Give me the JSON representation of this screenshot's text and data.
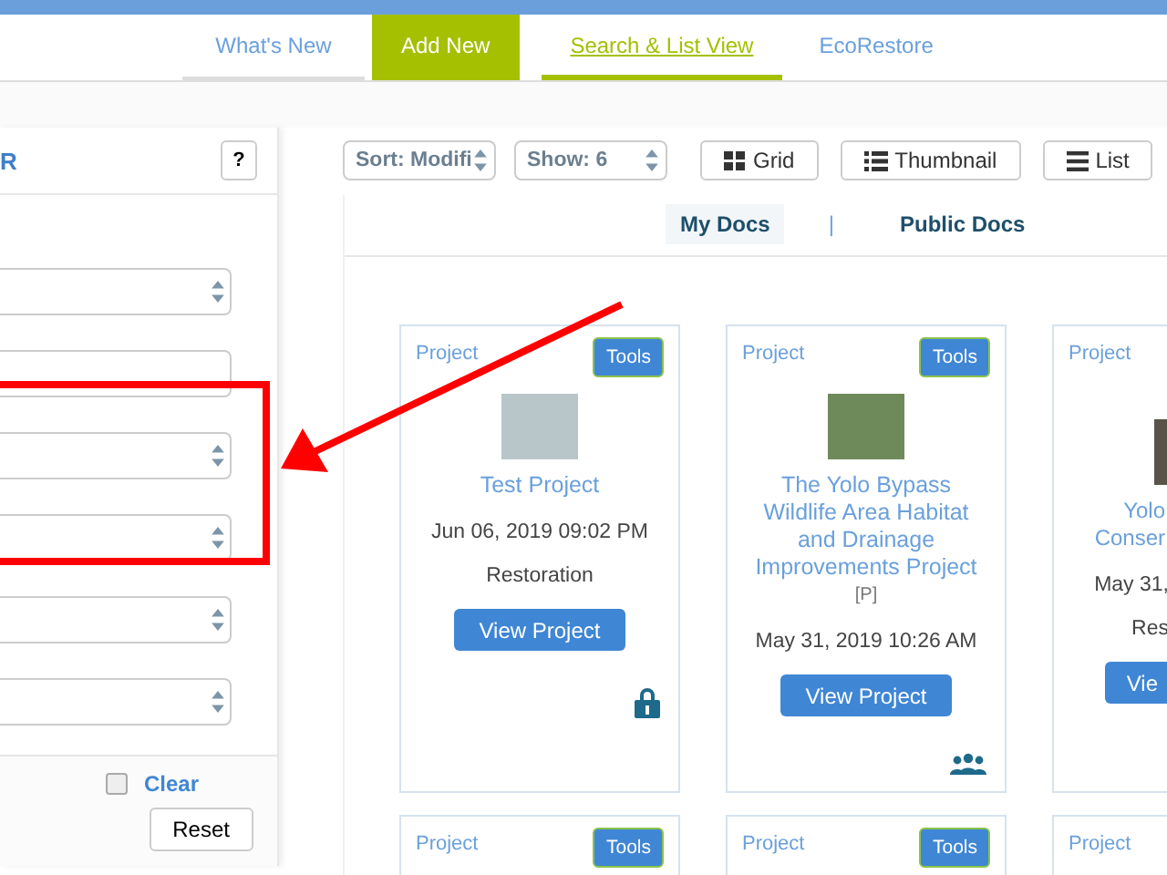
{
  "nav": {
    "tabs": [
      {
        "label": "What's New",
        "selected": false,
        "highlighted": false
      },
      {
        "label": "Add New",
        "selected": false,
        "highlighted": true
      },
      {
        "label": "Search & List View",
        "selected": true,
        "highlighted": false
      },
      {
        "label": "EcoRestore",
        "selected": false,
        "highlighted": false
      }
    ]
  },
  "filter_panel": {
    "title": "R",
    "help": "?",
    "fields": [
      {
        "kind": "select"
      },
      {
        "kind": "input"
      },
      {
        "kind": "select"
      },
      {
        "kind": "select"
      },
      {
        "kind": "select"
      },
      {
        "kind": "select"
      }
    ],
    "clear": {
      "label": "Clear",
      "checked": false
    },
    "reset": "Reset"
  },
  "toolbar": {
    "sort": "Sort: Modifi",
    "show": "Show: 6",
    "views": [
      {
        "label": "Grid",
        "kind": "grid"
      },
      {
        "label": "Thumbnail",
        "kind": "thumbnail"
      },
      {
        "label": "List",
        "kind": "list"
      }
    ]
  },
  "doc_tabs": {
    "tabs": [
      {
        "label": "My Docs",
        "selected": true
      },
      {
        "label": "Public Docs",
        "selected": false
      }
    ],
    "separator": "|"
  },
  "cards": [
    {
      "type": "Project",
      "tools": "Tools",
      "title": "Test Project",
      "date": "Jun 06, 2019 09:02 PM",
      "category": "Restoration",
      "button": "View Project",
      "partial": false
    },
    {
      "type": "Project",
      "tools": "Tools",
      "title": "The Yolo Bypass Wildlife Area Habitat and Drainage Improvements Project",
      "note": "[P]",
      "date": "May 31, 2019 10:26 AM",
      "button": "View Project",
      "partial": false
    },
    {
      "type": "Project",
      "title": "Yolo\nConser",
      "date": "May 31,",
      "category": "Res",
      "button": "Vie",
      "partial": true
    }
  ],
  "next_cards": [
    {
      "type": "Project",
      "tools": "Tools"
    },
    {
      "type": "Project",
      "tools": "Tools"
    },
    {
      "type": "Project"
    }
  ],
  "annotation": {
    "highlight": true,
    "arrow": true
  }
}
